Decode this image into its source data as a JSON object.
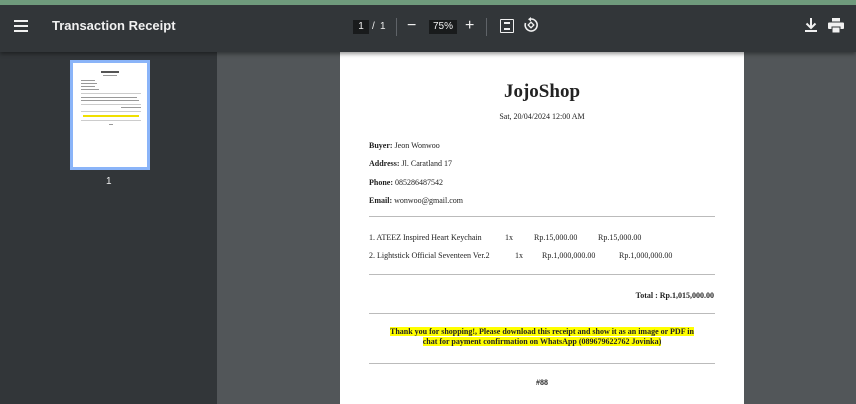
{
  "toolbar": {
    "title": "Transaction Receipt",
    "page_current": "1",
    "page_separator": "/",
    "page_total": "1",
    "zoom": "75%",
    "zoom_out_label": "−",
    "zoom_in_label": "+"
  },
  "sidebar": {
    "thumbnail_page_number": "1"
  },
  "receipt": {
    "shop_name": "JojoShop",
    "datetime": "Sat, 20/04/2024 12:00 AM",
    "buyer_label": "Buyer:",
    "buyer_value": "Jeon Wonwoo",
    "address_label": "Address:",
    "address_value": "Jl. Caratland 17",
    "phone_label": "Phone:",
    "phone_value": "085286487542",
    "email_label": "Email:",
    "email_value": "wonwoo@gmail.com",
    "items": [
      {
        "name": "1. ATEEZ Inspired Heart Keychain",
        "qty": "1x",
        "price": "Rp.15,000.00",
        "subtotal": "Rp.15,000.00"
      },
      {
        "name": "2. Lightstick Official Seventeen Ver.2",
        "qty": "1x",
        "price": "Rp.1,000,000.00",
        "subtotal": "Rp.1,000,000.00"
      }
    ],
    "total": "Total : Rp.1,015,000.00",
    "notice_line1": "Thank you for shopping!, Please download this receipt and show it as an image or PDF in",
    "notice_line2": "chat for payment confirmation on WhatsApp (089679622762 Jovinka)",
    "order_code": "#88"
  },
  "colors": {
    "toolbar_bg": "#323639",
    "viewer_bg": "#525659",
    "thumbnail_border": "#8ab4f8",
    "highlight": "#ffff00"
  }
}
